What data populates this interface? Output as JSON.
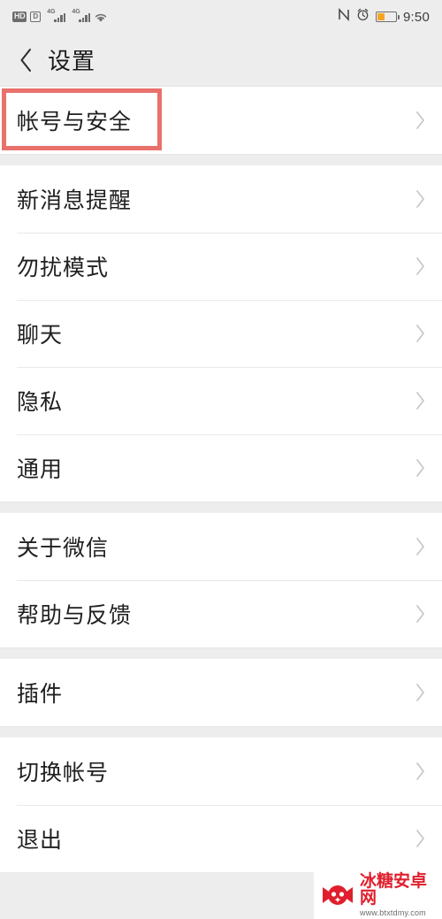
{
  "status_bar": {
    "hd_label": "HD",
    "data_label": "D",
    "network_1": "4G",
    "network_2": "4G",
    "wifi_icon": "wifi-icon",
    "nfc_icon": "nfc-icon",
    "alarm_icon": "alarm-icon",
    "battery_icon": "battery-icon",
    "battery_fill_color": "#f5a623",
    "time": "9:50"
  },
  "nav": {
    "back_icon": "chevron-left-icon",
    "title": "设置"
  },
  "highlight": {
    "color": "#e8716c",
    "target": "帐号与安全"
  },
  "colors": {
    "page_background": "#ededed",
    "row_background": "#ffffff",
    "divider": "#e9e9e9",
    "text_primary": "#1f1f1f",
    "chevron": "#c8c8c8",
    "badge_red": "#f74c42"
  },
  "groups": [
    {
      "id": "group-account",
      "rows": [
        {
          "label": "帐号与安全",
          "badge": false,
          "chevron": "chevron-right-icon"
        }
      ]
    },
    {
      "id": "group-preferences",
      "rows": [
        {
          "label": "新消息提醒",
          "badge": false,
          "chevron": "chevron-right-icon"
        },
        {
          "label": "勿扰模式",
          "badge": false,
          "chevron": "chevron-right-icon"
        },
        {
          "label": "聊天",
          "badge": false,
          "chevron": "chevron-right-icon"
        },
        {
          "label": "隐私",
          "badge": false,
          "chevron": "chevron-right-icon"
        },
        {
          "label": "通用",
          "badge": false,
          "chevron": "chevron-right-icon"
        }
      ]
    },
    {
      "id": "group-about",
      "rows": [
        {
          "label": "关于微信",
          "badge": false,
          "chevron": "chevron-right-icon"
        },
        {
          "label": "帮助与反馈",
          "badge": false,
          "chevron": "chevron-right-icon"
        }
      ]
    },
    {
      "id": "group-plugins",
      "rows": [
        {
          "label": "插件",
          "badge": true,
          "chevron": "chevron-right-icon"
        }
      ]
    },
    {
      "id": "group-session",
      "rows": [
        {
          "label": "切换帐号",
          "badge": false,
          "chevron": "chevron-right-icon"
        },
        {
          "label": "退出",
          "badge": false,
          "chevron": "chevron-right-icon"
        }
      ]
    }
  ],
  "watermark": {
    "title": "冰糖安卓网",
    "url": "www.btxtdmy.com",
    "logo_icon": "candy-gamepad-logo-icon",
    "logo_color": "#e01f2d"
  }
}
